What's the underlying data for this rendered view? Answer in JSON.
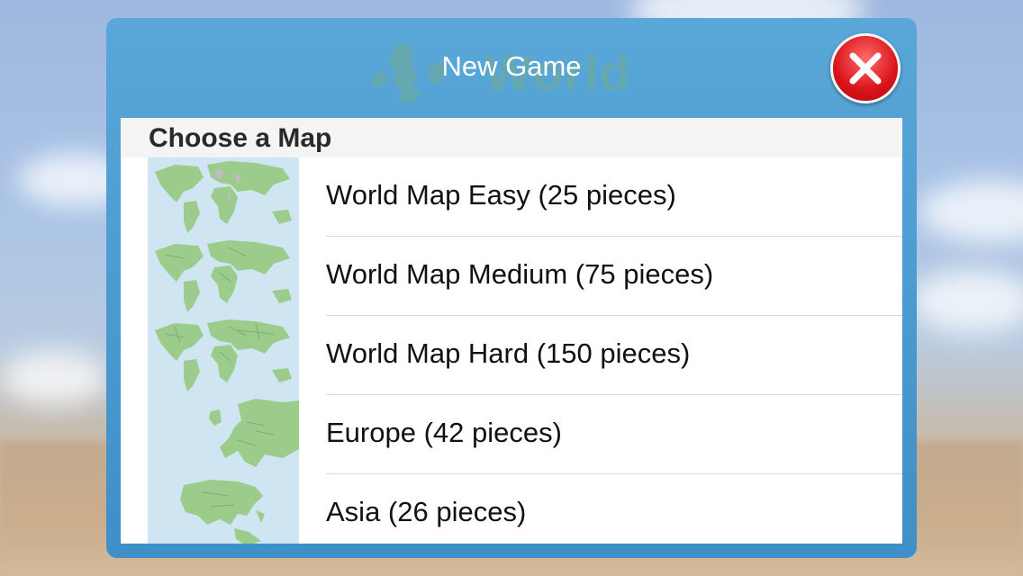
{
  "dialog": {
    "title": "New Game",
    "watermark_text": "World",
    "close_icon": "close-icon"
  },
  "section": {
    "title": "Choose a Map"
  },
  "maps": [
    {
      "label": "World Map Easy (25 pieces)",
      "thumb_icon": "world-map-thumbnail"
    },
    {
      "label": "World Map Medium (75 pieces)",
      "thumb_icon": "world-map-thumbnail"
    },
    {
      "label": "World Map Hard (150 pieces)",
      "thumb_icon": "world-map-thumbnail"
    },
    {
      "label": "Europe (42 pieces)",
      "thumb_icon": "europe-map-thumbnail"
    },
    {
      "label": "Asia (26 pieces)",
      "thumb_icon": "asia-map-thumbnail"
    }
  ],
  "colors": {
    "header_blue": "#4a9bd2",
    "land_green": "#9ccc8c",
    "sea_blue": "#cfe6f2",
    "close_red": "#d9131a"
  }
}
